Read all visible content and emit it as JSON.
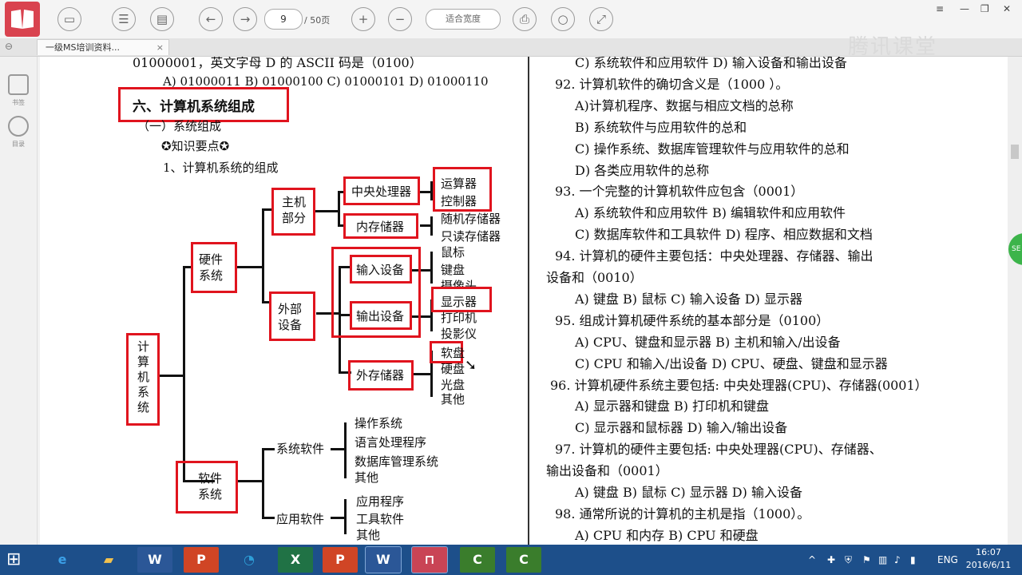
{
  "toolbar": {
    "page_current": "9",
    "page_total": "/ 50页",
    "fit_mode": "适合宽度",
    "icons": [
      "folder-icon",
      "document-icon",
      "book-icon",
      "back-icon",
      "forward-icon",
      "zoom-in-icon",
      "zoom-out-icon",
      "print-icon",
      "search-icon",
      "fullscreen-icon"
    ]
  },
  "tab": {
    "title": "一级MS培训资料...",
    "close": "×"
  },
  "watermark": "腾讯课堂",
  "sidebar": {
    "bookmark": "书签",
    "outline": "目录"
  },
  "left": {
    "line1": "01000001，英文字母 D 的 ASCII 码是（0100）",
    "line2": "A) 01000011   B) 01000100    C) 01000101  D) 01000110",
    "section_title": "六、计算机系统组成",
    "subsection": "（一）系统组成",
    "knowledge": "知识要点",
    "item1": "1、计算机系统的组成",
    "tree": {
      "root": [
        "计",
        "算",
        "机",
        "系",
        "统"
      ],
      "hardware": [
        "硬件",
        "系统"
      ],
      "host": [
        "主机",
        "部分"
      ],
      "cpu": "中央处理器",
      "alu": "运算器",
      "controller": "控制器",
      "memory": "内存储器",
      "ram": "随机存储器",
      "rom": "只读存储器",
      "peripheral": [
        "外部",
        "设备"
      ],
      "input": "输入设备",
      "mouse": "鼠标",
      "keyboard": "键盘",
      "camera": "摄像头",
      "output": "输出设备",
      "display": "显示器",
      "printer": "打印机",
      "projector": "投影仪",
      "storage": "外存储器",
      "floppy": "软盘",
      "harddisk": "硬盘",
      "optical": "光盘",
      "other1": "其他",
      "software": [
        "软件",
        "系统"
      ],
      "system_sw": "系统软件",
      "os": "操作系统",
      "lang": "语言处理程序",
      "dbms": "数据库管理系统",
      "other2": "其他",
      "app_sw": "应用软件",
      "app": "应用程序",
      "tools": "工具软件",
      "other3": "其他"
    }
  },
  "right": {
    "lines": [
      "C)  系统软件和应用软件      D)  输入设备和输出设备",
      "92. 计算机软件的确切含义是（1000 ）。",
      "A)计算机程序、数据与相应文档的总称",
      "B)  系统软件与应用软件的总和",
      "C)  操作系统、数据库管理软件与应用软件的总和",
      "D)  各类应用软件的总称",
      "93. 一个完整的计算机软件应包含（0001）",
      "A)  系统软件和应用软件     B)  编辑软件和应用软件",
      "C)  数据库软件和工具软件   D)  程序、相应数据和文档",
      "94. 计算机的硬件主要包括：中央处理器、存储器、输出",
      "设备和（0010）",
      "A)  键盘        B)  鼠标         C)  输入设备    D)  显示器",
      "95. 组成计算机硬件系统的基本部分是（0100）",
      "A) CPU、键盘和显示器       B)  主机和输入/出设备",
      "C) CPU 和输入/出设备  D) CPU、硬盘、键盘和显示器",
      "96.  计算机硬件系统主要包括: 中央处理器(CPU)、存储器(0001）",
      "A)  显示器和键盘              B)  打印机和键盘",
      "C)  显示器和鼠标器            D)  输入/输出设备",
      "97. 计算机的硬件主要包括: 中央处理器(CPU)、存储器、",
      "输出设备和（0001）",
      "A)  键盘          B)  鼠标          C)  显示器       D)  输入设备",
      "98. 通常所说的计算机的主机是指（1000）。",
      "A) CPU 和内存                      B) CPU 和硬盘"
    ]
  },
  "taskbar": {
    "lang": "ENG",
    "time": "16:07",
    "date": "2016/6/11",
    "apps": [
      "ie-icon",
      "explorer-icon",
      "word-icon",
      "powerpoint-icon",
      "edge-icon",
      "excel-icon",
      "reader-icon",
      "word-active-icon",
      "pdf-active-icon",
      "camtasia-icon",
      "camtasia2-icon"
    ]
  },
  "float_button": "SE"
}
